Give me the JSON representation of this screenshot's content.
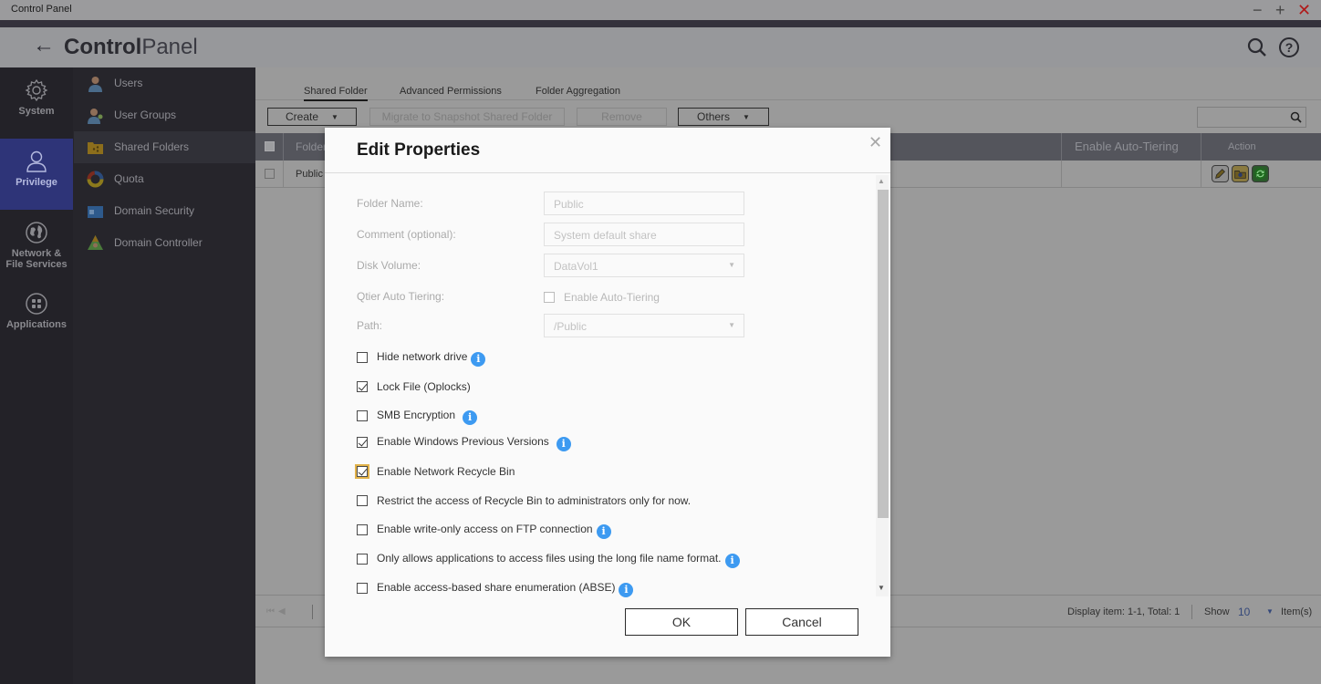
{
  "window": {
    "title": "Control Panel",
    "minimize": "−",
    "maximize": "+",
    "close": "✕"
  },
  "header": {
    "back": "←",
    "title_bold": "Control",
    "title_light": "Panel",
    "icons": [
      "search-icon",
      "help-icon"
    ]
  },
  "rail": {
    "items": [
      {
        "label": "System",
        "icon": "gear-icon"
      },
      {
        "label": "Privilege",
        "icon": "user-icon",
        "active": true
      },
      {
        "label_line1": "Network &",
        "label_line2": "File Services",
        "icon": "globe-icon"
      },
      {
        "label": "Applications",
        "icon": "apps-icon"
      }
    ]
  },
  "submenu": {
    "items": [
      {
        "label": "Users",
        "icon": "user-icon"
      },
      {
        "label": "User Groups",
        "icon": "user-group-icon"
      },
      {
        "label": "Shared Folders",
        "icon": "shared-folder-icon",
        "active": true
      },
      {
        "label": "Quota",
        "icon": "quota-icon"
      },
      {
        "label": "Domain Security",
        "icon": "domain-security-icon"
      },
      {
        "label": "Domain Controller",
        "icon": "domain-controller-icon"
      }
    ]
  },
  "main": {
    "tabs": [
      {
        "label": "Shared Folder",
        "active": true
      },
      {
        "label": "Advanced Permissions"
      },
      {
        "label": "Folder Aggregation"
      }
    ],
    "toolbar": {
      "create": "Create",
      "migrate": "Migrate to Snapshot Shared Folder",
      "remove": "Remove",
      "others": "Others",
      "search_value": ""
    },
    "table": {
      "columns": [
        "Folder",
        "Enable Auto-Tiering",
        "Action"
      ],
      "rows": [
        {
          "folder": "Public",
          "auto_tiering": ""
        }
      ],
      "action_icons": [
        "edit-icon",
        "permissions-icon",
        "refresh-icon"
      ]
    },
    "footer": {
      "display": "Display item: 1-1, Total: 1",
      "show_label": "Show",
      "show_value": "10",
      "items_label": "Item(s)"
    }
  },
  "dialog": {
    "title": "Edit Properties",
    "fields": {
      "folder_name": {
        "label": "Folder Name:",
        "value": "Public"
      },
      "comment": {
        "label": "Comment (optional):",
        "value": "System default share"
      },
      "disk_volume": {
        "label": "Disk Volume:",
        "value": "DataVol1"
      },
      "qtier": {
        "label": "Qtier Auto Tiering:",
        "checkbox_label": "Enable Auto-Tiering",
        "checked": false
      },
      "path": {
        "label": "Path:",
        "value": "/Public"
      }
    },
    "options": [
      {
        "label": "Hide network drive",
        "checked": false,
        "info": true
      },
      {
        "label": "Lock File (Oplocks)",
        "checked": true,
        "info": false
      },
      {
        "label": "SMB Encryption",
        "checked": false,
        "info": true
      },
      {
        "label": "Enable Windows Previous Versions",
        "checked": true,
        "info": true
      },
      {
        "label": "Enable Network Recycle Bin",
        "checked": true,
        "info": false,
        "focused": true
      },
      {
        "label": "Restrict the access of Recycle Bin to administrators only for now.",
        "checked": false,
        "info": false
      },
      {
        "label": "Enable write-only access on FTP connection",
        "checked": false,
        "info": true
      },
      {
        "label": "Only allows applications to access files using the long file name format.",
        "checked": false,
        "info": true
      },
      {
        "label": "Enable access-based share enumeration (ABSE)",
        "checked": false,
        "info": true
      }
    ],
    "ok": "OK",
    "cancel": "Cancel",
    "close": "✕"
  },
  "colors": {
    "rail_active": "#2e3478",
    "info_icon": "#3d9af1",
    "focus_outline": "#e2b24a",
    "close_red": "#b01a1a"
  }
}
